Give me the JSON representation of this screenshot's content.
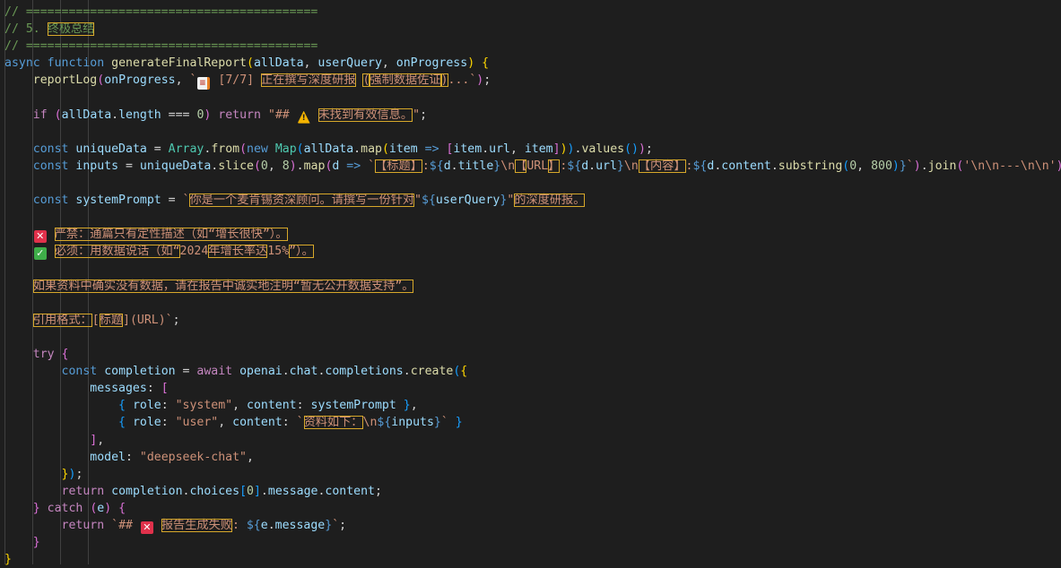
{
  "colors": {
    "background": "#1e1e1e",
    "comment": "#6a9955",
    "keyword": "#569cd6",
    "control": "#c586c0",
    "function": "#dcdcaa",
    "variable": "#9cdcfe",
    "string": "#ce9178",
    "number": "#b5cea8",
    "type": "#4ec9b0",
    "highlight_border": "#d7a82a"
  },
  "lines": [
    [
      [
        "comment",
        "// ========================================="
      ]
    ],
    [
      [
        "comment",
        "// 5. "
      ],
      [
        "comment",
        "终极总结",
        "hl"
      ]
    ],
    [
      [
        "comment",
        "// ========================================="
      ]
    ],
    [
      [
        "keyword",
        "async"
      ],
      [
        "punct",
        " "
      ],
      [
        "keyword",
        "function"
      ],
      [
        "punct",
        " "
      ],
      [
        "func",
        "generateFinalReport"
      ],
      [
        "bracket1",
        "("
      ],
      [
        "var",
        "allData"
      ],
      [
        "punct",
        ", "
      ],
      [
        "var",
        "userQuery"
      ],
      [
        "punct",
        ", "
      ],
      [
        "var",
        "onProgress"
      ],
      [
        "bracket1",
        ")"
      ],
      [
        "punct",
        " "
      ],
      [
        "bracket1",
        "{"
      ]
    ],
    [
      [
        "punct",
        "    "
      ],
      [
        "func",
        "reportLog"
      ],
      [
        "bracket2",
        "("
      ],
      [
        "var",
        "onProgress"
      ],
      [
        "punct",
        ", "
      ],
      [
        "string",
        "`"
      ],
      [
        "icon",
        "doc"
      ],
      [
        "string",
        " [7/7] "
      ],
      [
        "string",
        "正在撰写深度研报",
        "hl"
      ],
      [
        "string",
        " "
      ],
      [
        "string",
        "(",
        "hl"
      ],
      [
        "string",
        "强制数据佐证",
        "hl"
      ],
      [
        "string",
        ")",
        "hl"
      ],
      [
        "string",
        "...`"
      ],
      [
        "bracket2",
        ")"
      ],
      [
        "punct",
        ";"
      ]
    ],
    [],
    [
      [
        "punct",
        "    "
      ],
      [
        "control",
        "if"
      ],
      [
        "punct",
        " "
      ],
      [
        "bracket2",
        "("
      ],
      [
        "var",
        "allData"
      ],
      [
        "punct",
        "."
      ],
      [
        "var",
        "length"
      ],
      [
        "punct",
        " === "
      ],
      [
        "number",
        "0"
      ],
      [
        "bracket2",
        ")"
      ],
      [
        "punct",
        " "
      ],
      [
        "control",
        "return"
      ],
      [
        "punct",
        " "
      ],
      [
        "string",
        "\"## "
      ],
      [
        "icon",
        "warn"
      ],
      [
        "string",
        " "
      ],
      [
        "string",
        "未找到有效信息。",
        "hl"
      ],
      [
        "string",
        "\""
      ],
      [
        "punct",
        ";"
      ]
    ],
    [],
    [
      [
        "punct",
        "    "
      ],
      [
        "keyword",
        "const"
      ],
      [
        "punct",
        " "
      ],
      [
        "var",
        "uniqueData"
      ],
      [
        "punct",
        " = "
      ],
      [
        "type",
        "Array"
      ],
      [
        "punct",
        "."
      ],
      [
        "func",
        "from"
      ],
      [
        "bracket2",
        "("
      ],
      [
        "keyword",
        "new"
      ],
      [
        "punct",
        " "
      ],
      [
        "type",
        "Map"
      ],
      [
        "bracket3",
        "("
      ],
      [
        "var",
        "allData"
      ],
      [
        "punct",
        "."
      ],
      [
        "func",
        "map"
      ],
      [
        "bracket1",
        "("
      ],
      [
        "var",
        "item"
      ],
      [
        "punct",
        " "
      ],
      [
        "keyword",
        "=>"
      ],
      [
        "punct",
        " "
      ],
      [
        "bracket2",
        "["
      ],
      [
        "var",
        "item"
      ],
      [
        "punct",
        "."
      ],
      [
        "var",
        "url"
      ],
      [
        "punct",
        ", "
      ],
      [
        "var",
        "item"
      ],
      [
        "bracket2",
        "]"
      ],
      [
        "bracket1",
        ")"
      ],
      [
        "bracket3",
        ")"
      ],
      [
        "punct",
        "."
      ],
      [
        "func",
        "values"
      ],
      [
        "bracket3",
        "()"
      ],
      [
        "bracket2",
        ")"
      ],
      [
        "punct",
        ";"
      ]
    ],
    [
      [
        "punct",
        "    "
      ],
      [
        "keyword",
        "const"
      ],
      [
        "punct",
        " "
      ],
      [
        "var",
        "inputs"
      ],
      [
        "punct",
        " = "
      ],
      [
        "var",
        "uniqueData"
      ],
      [
        "punct",
        "."
      ],
      [
        "func",
        "slice"
      ],
      [
        "bracket2",
        "("
      ],
      [
        "number",
        "0"
      ],
      [
        "punct",
        ", "
      ],
      [
        "number",
        "8"
      ],
      [
        "bracket2",
        ")"
      ],
      [
        "punct",
        "."
      ],
      [
        "func",
        "map"
      ],
      [
        "bracket2",
        "("
      ],
      [
        "var",
        "d"
      ],
      [
        "punct",
        " "
      ],
      [
        "keyword",
        "=>"
      ],
      [
        "punct",
        " "
      ],
      [
        "string",
        "`"
      ],
      [
        "string",
        "【标题】",
        "hl"
      ],
      [
        "string",
        ":"
      ],
      [
        "interp",
        "${"
      ],
      [
        "var",
        "d"
      ],
      [
        "punct",
        "."
      ],
      [
        "var",
        "title"
      ],
      [
        "interp",
        "}"
      ],
      [
        "string",
        "\\n"
      ],
      [
        "string",
        "【",
        "hl"
      ],
      [
        "string",
        "URL"
      ],
      [
        "string",
        "】",
        "hl"
      ],
      [
        "string",
        ":"
      ],
      [
        "interp",
        "${"
      ],
      [
        "var",
        "d"
      ],
      [
        "punct",
        "."
      ],
      [
        "var",
        "url"
      ],
      [
        "interp",
        "}"
      ],
      [
        "string",
        "\\n"
      ],
      [
        "string",
        "【内容】",
        "hl"
      ],
      [
        "string",
        ":"
      ],
      [
        "interp",
        "${"
      ],
      [
        "var",
        "d"
      ],
      [
        "punct",
        "."
      ],
      [
        "var",
        "content"
      ],
      [
        "punct",
        "."
      ],
      [
        "func",
        "substring"
      ],
      [
        "bracket3",
        "("
      ],
      [
        "number",
        "0"
      ],
      [
        "punct",
        ", "
      ],
      [
        "number",
        "800"
      ],
      [
        "bracket3",
        ")"
      ],
      [
        "interp",
        "}"
      ],
      [
        "string",
        "`"
      ],
      [
        "bracket2",
        ")"
      ],
      [
        "punct",
        "."
      ],
      [
        "func",
        "join"
      ],
      [
        "bracket2",
        "("
      ],
      [
        "string",
        "'\\n\\n---\\n\\n'"
      ],
      [
        "bracket2",
        ")"
      ],
      [
        "punct",
        ";"
      ]
    ],
    [],
    [
      [
        "punct",
        "    "
      ],
      [
        "keyword",
        "const"
      ],
      [
        "punct",
        " "
      ],
      [
        "var",
        "systemPrompt"
      ],
      [
        "punct",
        " = "
      ],
      [
        "string",
        "`"
      ],
      [
        "string",
        "你是一个麦肯锡资深顾问。请撰写一份针对",
        "hl"
      ],
      [
        "string",
        "\""
      ],
      [
        "interp",
        "${"
      ],
      [
        "var",
        "userQuery"
      ],
      [
        "interp",
        "}"
      ],
      [
        "string",
        "\""
      ],
      [
        "string",
        "的深度研报。",
        "hl"
      ]
    ],
    [],
    [
      [
        "string",
        "    "
      ],
      [
        "icon",
        "x"
      ],
      [
        "string",
        " "
      ],
      [
        "string",
        "严禁：通篇只有定性描述（如“增长很快”）。",
        "hl"
      ]
    ],
    [
      [
        "string",
        "    "
      ],
      [
        "icon",
        "check"
      ],
      [
        "string",
        " "
      ],
      [
        "string",
        "必须：用数据说话（如“",
        "hl"
      ],
      [
        "string",
        "2024"
      ],
      [
        "string",
        "年增长率达",
        "hl"
      ],
      [
        "string",
        "15%"
      ],
      [
        "string",
        "”）。",
        "hl"
      ]
    ],
    [],
    [
      [
        "string",
        "    "
      ],
      [
        "string",
        "如果资料中确实没有数据，请在报告中诚实地注明“暂无公开数据支持”。",
        "hl"
      ]
    ],
    [],
    [
      [
        "string",
        "    "
      ],
      [
        "string",
        "引用格式：",
        "hl"
      ],
      [
        "string",
        "["
      ],
      [
        "string",
        "标题",
        "hl"
      ],
      [
        "string",
        "](URL)`"
      ],
      [
        "punct",
        ";"
      ]
    ],
    [],
    [
      [
        "punct",
        "    "
      ],
      [
        "control",
        "try"
      ],
      [
        "punct",
        " "
      ],
      [
        "bracket2",
        "{"
      ]
    ],
    [
      [
        "punct",
        "        "
      ],
      [
        "keyword",
        "const"
      ],
      [
        "punct",
        " "
      ],
      [
        "var",
        "completion"
      ],
      [
        "punct",
        " = "
      ],
      [
        "control",
        "await"
      ],
      [
        "punct",
        " "
      ],
      [
        "var",
        "openai"
      ],
      [
        "punct",
        "."
      ],
      [
        "var",
        "chat"
      ],
      [
        "punct",
        "."
      ],
      [
        "var",
        "completions"
      ],
      [
        "punct",
        "."
      ],
      [
        "func",
        "create"
      ],
      [
        "bracket3",
        "("
      ],
      [
        "bracket1",
        "{"
      ]
    ],
    [
      [
        "punct",
        "            "
      ],
      [
        "var",
        "messages"
      ],
      [
        "punct",
        ": "
      ],
      [
        "bracket2",
        "["
      ]
    ],
    [
      [
        "punct",
        "                "
      ],
      [
        "bracket3",
        "{"
      ],
      [
        "punct",
        " "
      ],
      [
        "var",
        "role"
      ],
      [
        "punct",
        ": "
      ],
      [
        "string",
        "\"system\""
      ],
      [
        "punct",
        ", "
      ],
      [
        "var",
        "content"
      ],
      [
        "punct",
        ": "
      ],
      [
        "var",
        "systemPrompt"
      ],
      [
        "punct",
        " "
      ],
      [
        "bracket3",
        "}"
      ],
      [
        "punct",
        ","
      ]
    ],
    [
      [
        "punct",
        "                "
      ],
      [
        "bracket3",
        "{"
      ],
      [
        "punct",
        " "
      ],
      [
        "var",
        "role"
      ],
      [
        "punct",
        ": "
      ],
      [
        "string",
        "\"user\""
      ],
      [
        "punct",
        ", "
      ],
      [
        "var",
        "content"
      ],
      [
        "punct",
        ": "
      ],
      [
        "string",
        "`"
      ],
      [
        "string",
        "资料如下：",
        "hl"
      ],
      [
        "string",
        "\\n"
      ],
      [
        "interp",
        "${"
      ],
      [
        "var",
        "inputs"
      ],
      [
        "interp",
        "}"
      ],
      [
        "string",
        "`"
      ],
      [
        "punct",
        " "
      ],
      [
        "bracket3",
        "}"
      ]
    ],
    [
      [
        "punct",
        "            "
      ],
      [
        "bracket2",
        "]"
      ],
      [
        "punct",
        ","
      ]
    ],
    [
      [
        "punct",
        "            "
      ],
      [
        "var",
        "model"
      ],
      [
        "punct",
        ": "
      ],
      [
        "string",
        "\"deepseek-chat\""
      ],
      [
        "punct",
        ","
      ]
    ],
    [
      [
        "punct",
        "        "
      ],
      [
        "bracket1",
        "}"
      ],
      [
        "bracket3",
        ")"
      ],
      [
        "punct",
        ";"
      ]
    ],
    [
      [
        "punct",
        "        "
      ],
      [
        "control",
        "return"
      ],
      [
        "punct",
        " "
      ],
      [
        "var",
        "completion"
      ],
      [
        "punct",
        "."
      ],
      [
        "var",
        "choices"
      ],
      [
        "bracket3",
        "["
      ],
      [
        "number",
        "0"
      ],
      [
        "bracket3",
        "]"
      ],
      [
        "punct",
        "."
      ],
      [
        "var",
        "message"
      ],
      [
        "punct",
        "."
      ],
      [
        "var",
        "content"
      ],
      [
        "punct",
        ";"
      ]
    ],
    [
      [
        "punct",
        "    "
      ],
      [
        "bracket2",
        "}"
      ],
      [
        "punct",
        " "
      ],
      [
        "control",
        "catch"
      ],
      [
        "punct",
        " "
      ],
      [
        "bracket2",
        "("
      ],
      [
        "var",
        "e"
      ],
      [
        "bracket2",
        ")"
      ],
      [
        "punct",
        " "
      ],
      [
        "bracket2",
        "{"
      ]
    ],
    [
      [
        "punct",
        "        "
      ],
      [
        "control",
        "return"
      ],
      [
        "punct",
        " "
      ],
      [
        "string",
        "`## "
      ],
      [
        "icon",
        "x"
      ],
      [
        "string",
        " "
      ],
      [
        "string",
        "报告生成失败",
        "hl"
      ],
      [
        "string",
        ": "
      ],
      [
        "interp",
        "${"
      ],
      [
        "var",
        "e"
      ],
      [
        "punct",
        "."
      ],
      [
        "var",
        "message"
      ],
      [
        "interp",
        "}"
      ],
      [
        "string",
        "`"
      ],
      [
        "punct",
        ";"
      ]
    ],
    [
      [
        "punct",
        "    "
      ],
      [
        "bracket2",
        "}"
      ]
    ],
    [
      [
        "bracket1",
        "}"
      ]
    ]
  ]
}
